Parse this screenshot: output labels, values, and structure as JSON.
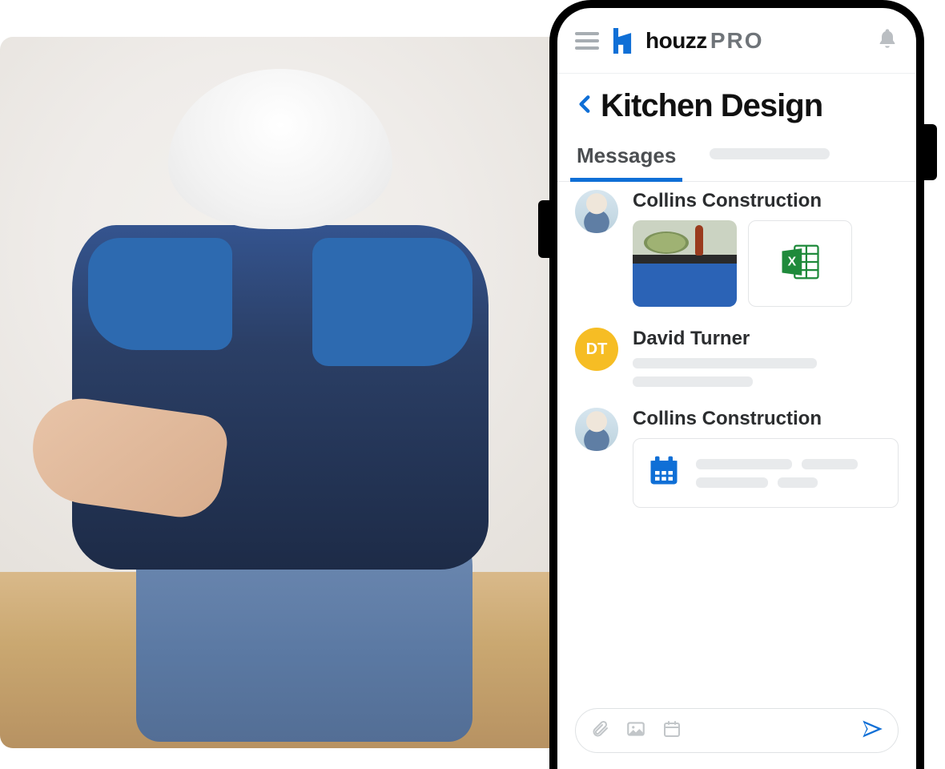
{
  "brand": {
    "name": "houzz",
    "suffix": "PRO"
  },
  "page": {
    "title": "Kitchen Design",
    "tab_active": "Messages"
  },
  "threads": [
    {
      "name": "Collins Construction",
      "avatar_type": "photo",
      "attachments": [
        {
          "type": "photo",
          "name": "kitchen-island-thumb"
        },
        {
          "type": "excel",
          "name": "spreadsheet-attachment"
        }
      ]
    },
    {
      "name": "David Turner",
      "avatar_type": "initials",
      "avatar_initials": "DT"
    },
    {
      "name": "Collins Construction",
      "avatar_type": "photo",
      "attachments": [
        {
          "type": "schedule",
          "name": "schedule-card"
        }
      ]
    }
  ]
}
